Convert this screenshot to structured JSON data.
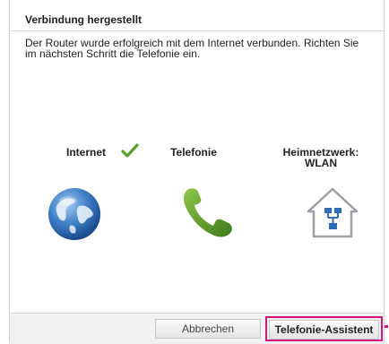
{
  "dialog": {
    "title": "Verbindung hergestellt",
    "message": "Der Router wurde erfolgreich mit dem Internet verbunden. Richten Sie im nächsten Schritt die Telefonie ein."
  },
  "status": {
    "internet": {
      "label": "Internet",
      "connected": true,
      "icon": "globe-icon"
    },
    "telefonie": {
      "label": "Telefonie",
      "icon": "phone-icon"
    },
    "heimnetz": {
      "label": "Heimnetzwerk: WLAN",
      "icon": "home-network-icon"
    }
  },
  "buttons": {
    "cancel_label": "Abbrechen",
    "primary_label": "Telefonie-Assistent"
  },
  "colors": {
    "check_green": "#5c9e2e",
    "phone_green": "#5b9a2a",
    "highlight_magenta": "#d0177d",
    "globe_blue": "#1f5fa8"
  }
}
